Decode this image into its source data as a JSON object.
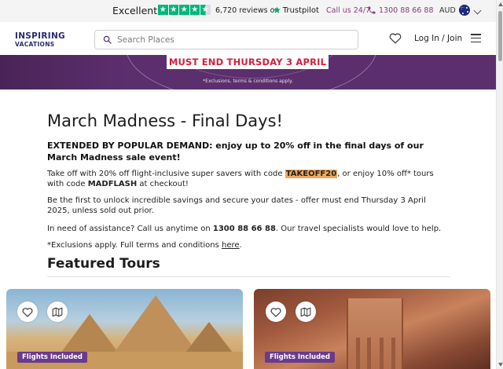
{
  "trustbar": {
    "rating_label": "Excellent",
    "reviews_text": "6,720 reviews on",
    "trustpilot_label": "Trustpilot",
    "call_label": "Call us 24/7",
    "phone_number": "1300 88 66 88",
    "currency": "AUD",
    "star_rating_fraction": 0.9,
    "star_color": "#00b67a"
  },
  "header": {
    "logo_line1": "INSPIRING",
    "logo_line2": "VACATIONS",
    "search_placeholder": "Search Places",
    "login_label": "Log In / Join"
  },
  "banner": {
    "headline": "MUST END THURSDAY 3 APRIL",
    "note": "*Exclusions, terms & conditions apply.",
    "bg_color": "#5b2f6d"
  },
  "main": {
    "title": "March Madness - Final Days!",
    "lead": "EXTENDED BY POPULAR DEMAND: enjoy up to 20% off in the final days of our March Madness sale event!",
    "p1_a": "Take off with 20% off flight-inclusive super savers with code ",
    "p1_code1": "TAKEOFF20",
    "p1_b": ", or enjoy 10% off* tours with code ",
    "p1_code2": "MADFLASH",
    "p1_c": " at checkout!",
    "p2": "Be the first to unlock incredible savings and secure your dates - offer must end Thursday 3 April 2025, unless sold out prior.",
    "p3_a": "In need of assistance? Call us anytime on ",
    "p3_phone": "1300 88 66 88",
    "p3_b": ". Our travel specialists would love to help.",
    "p4_a": "*Exclusions apply. Full terms and conditions ",
    "p4_link": "here",
    "p4_b": ".",
    "featured_title": "Featured Tours"
  },
  "tours": [
    {
      "badge": "Flights Included",
      "image_subject": "pyramids"
    },
    {
      "badge": "Flights Included",
      "image_subject": "petra"
    }
  ]
}
